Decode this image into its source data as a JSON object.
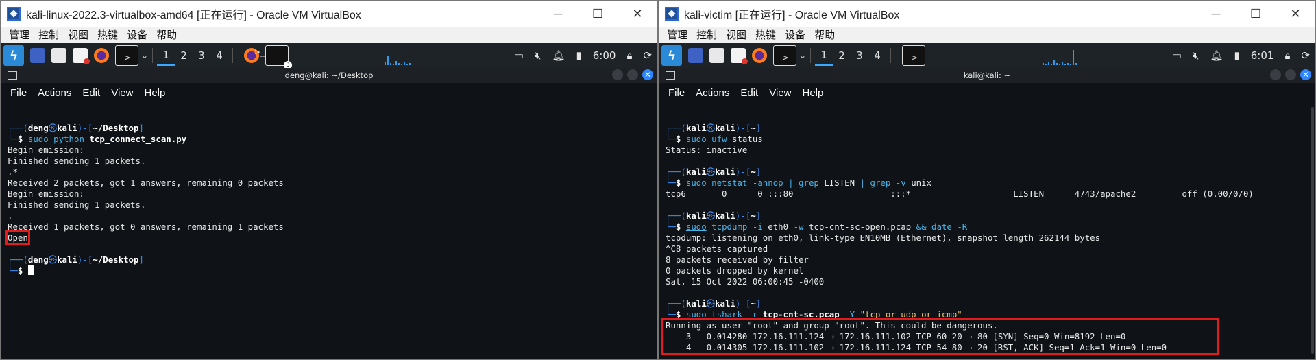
{
  "left": {
    "window_title": "kali-linux-2022.3-virtualbox-amd64 [正在运行] - Oracle VM VirtualBox",
    "menus": [
      "管理",
      "控制",
      "视图",
      "热键",
      "设备",
      "帮助"
    ],
    "workspaces": [
      "1",
      "2",
      "3",
      "4"
    ],
    "clock": "6:00",
    "task_badge": "3",
    "term_title": "deng@kali: ~/Desktop",
    "term_menu": [
      "File",
      "Actions",
      "Edit",
      "View",
      "Help"
    ],
    "prompt": {
      "user": "deng",
      "host": "kali",
      "dir": "~/Desktop"
    },
    "cmd": {
      "sudo": "sudo",
      "prog": "python",
      "arg": "tcp_connect_scan.py"
    },
    "output": [
      "Begin emission:",
      "Finished sending 1 packets.",
      ".*",
      "Received 2 packets, got 1 answers, remaining 0 packets",
      "Begin emission:",
      "Finished sending 1 packets.",
      ".",
      "Received 1 packets, got 0 answers, remaining 1 packets"
    ],
    "result": "Open"
  },
  "right": {
    "window_title": "kali-victim [正在运行] - Oracle VM VirtualBox",
    "menus": [
      "管理",
      "控制",
      "视图",
      "热键",
      "设备",
      "帮助"
    ],
    "workspaces": [
      "1",
      "2",
      "3",
      "4"
    ],
    "clock": "6:01",
    "term_title": "kali@kali: ~",
    "term_menu": [
      "File",
      "Actions",
      "Edit",
      "View",
      "Help"
    ],
    "prompt": {
      "user": "kali",
      "host": "kali",
      "dir": "~"
    },
    "cmd1": {
      "sudo": "sudo",
      "prog": "ufw",
      "args": "status"
    },
    "out1": "Status: inactive",
    "cmd2": {
      "sudo": "sudo",
      "prog": "netstat",
      "opt": "-annop",
      "pipe1": "|",
      "grep1": "grep",
      "arg1": "LISTEN",
      "pipe2": "|",
      "grep2": "grep",
      "opt2": "-v",
      "arg2": "unix"
    },
    "out2": "tcp6       0      0 :::80                   :::*                    LISTEN      4743/apache2         off (0.00/0/0)",
    "cmd3": {
      "sudo": "sudo",
      "prog": "tcpdump",
      "opt1": "-i",
      "a1": "eth0",
      "opt2": "-w",
      "a2": "tcp-cnt-sc-open.pcap",
      "and": "&&",
      "prog2": "date",
      "opt3": "-R"
    },
    "out3": [
      "tcpdump: listening on eth0, link-type EN10MB (Ethernet), snapshot length 262144 bytes",
      "^C8 packets captured",
      "8 packets received by filter",
      "0 packets dropped by kernel",
      "Sat, 15 Oct 2022 06:00:45 -0400"
    ],
    "cmd4": {
      "sudo": "sudo",
      "prog": "tshark",
      "opt1": "-r",
      "a1": "tcp-cnt-sc.pcap",
      "opt2": "-Y",
      "a2": "\"tcp or udp or icmp\""
    },
    "out4": [
      "Running as user \"root\" and group \"root\". This could be dangerous.",
      "    3   0.014280 172.16.111.124 → 172.16.111.102 TCP 60 20 → 80 [SYN] Seq=0 Win=8192 Len=0",
      "    4   0.014305 172.16.111.102 → 172.16.111.124 TCP 54 80 → 20 [RST, ACK] Seq=1 Ack=1 Win=0 Len=0"
    ]
  }
}
